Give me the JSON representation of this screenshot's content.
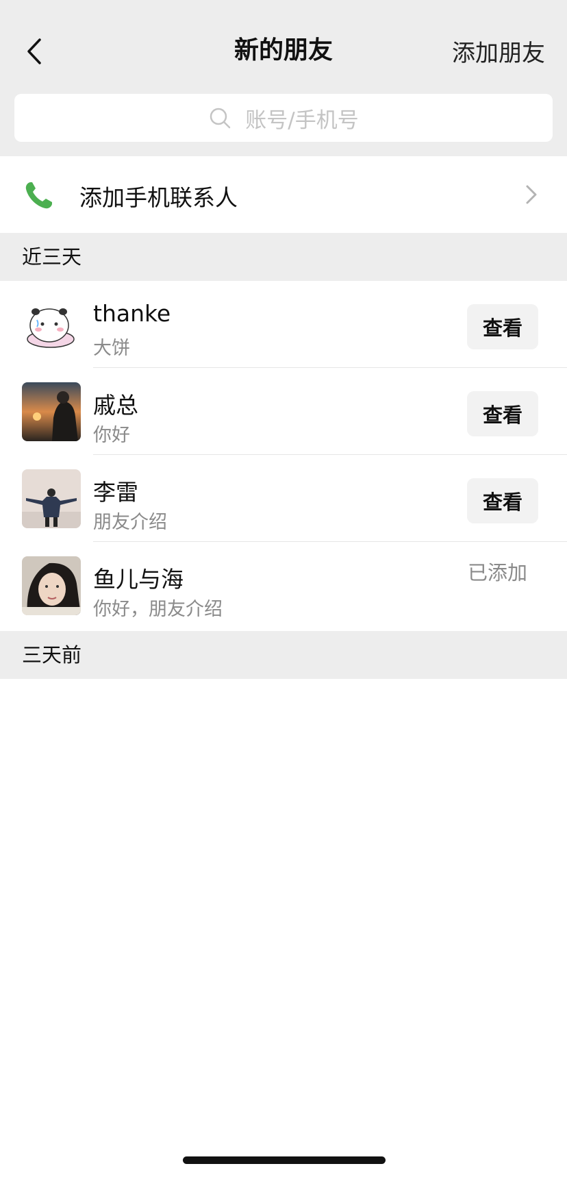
{
  "nav": {
    "title": "新的朋友",
    "action": "添加朋友"
  },
  "search": {
    "placeholder": "账号/手机号"
  },
  "phone_contacts": {
    "label": "添加手机联系人",
    "icon_color": "#4caf50"
  },
  "sections": {
    "recent": "近三天",
    "older": "三天前"
  },
  "friends": [
    {
      "name": "thanke",
      "message": "大饼",
      "action": "查看",
      "status": ""
    },
    {
      "name": "戚总",
      "message": "你好",
      "action": "查看",
      "status": ""
    },
    {
      "name": "李雷",
      "message": "朋友介绍",
      "action": "查看",
      "status": ""
    },
    {
      "name": "鱼儿与海",
      "message": "你好，朋友介绍",
      "action": "",
      "status": "已添加"
    }
  ]
}
